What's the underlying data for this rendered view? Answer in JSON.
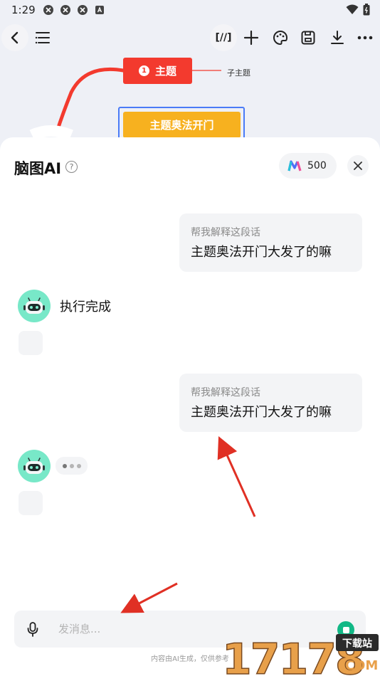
{
  "status_bar": {
    "time": "1:29"
  },
  "toolbar": {
    "format_label": "[//]"
  },
  "mindmap": {
    "main_topic": "主题",
    "main_topic_number": "1",
    "subtopic": "子主题",
    "selected_topic": "主题奥法开门",
    "colors": {
      "main": "#f33a2e",
      "selected": "#f7b11f",
      "line": "#f33a2e",
      "selection_border": "#4a7bf7"
    }
  },
  "panel": {
    "title": "脑图AI",
    "help": "?",
    "credits": "500",
    "messages": [
      {
        "role": "user",
        "hint": "帮我解释这段话",
        "text": "主题奥法开门大发了的嘛"
      },
      {
        "role": "assistant",
        "text": "执行完成"
      },
      {
        "role": "user",
        "hint": "帮我解释这段话",
        "text": "主题奥法开门大发了的嘛"
      },
      {
        "role": "assistant",
        "text": "",
        "typing": true
      }
    ],
    "input": {
      "placeholder": "发消息..."
    },
    "disclaimer": "内容由AI生成，仅供参考",
    "accent": "#12b886"
  },
  "watermark": {
    "number": "17178",
    "tag": "下载站",
    "domain": ".COM"
  }
}
